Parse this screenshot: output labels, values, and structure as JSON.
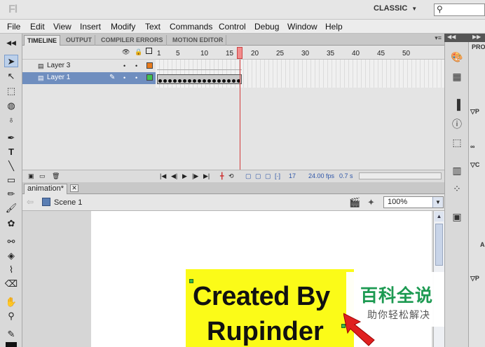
{
  "app": {
    "workspace": "CLASSIC",
    "search_placeholder": ""
  },
  "menu": [
    "File",
    "Edit",
    "View",
    "Insert",
    "Modify",
    "Text",
    "Commands",
    "Control",
    "Debug",
    "Window",
    "Help"
  ],
  "timeline": {
    "tabs": [
      "TIMELINE",
      "OUTPUT",
      "COMPILER ERRORS",
      "MOTION EDITOR"
    ],
    "active_tab": "TIMELINE",
    "layers": [
      {
        "name": "Layer 3",
        "color": "#e87b1c",
        "selected": false
      },
      {
        "name": "Layer 1",
        "color": "#3fc24f",
        "selected": true
      }
    ],
    "ruler": [
      "1",
      "5",
      "10",
      "15",
      "20",
      "25",
      "30",
      "35",
      "40",
      "45",
      "50"
    ],
    "current_frame": "17",
    "fps": "24.00 fps",
    "time": "0.7 s"
  },
  "document": {
    "tab_label": "animation*",
    "scene": "Scene 1",
    "zoom": "100%"
  },
  "stage": {
    "text_line1": "Created By",
    "text_line2": "Rupinder",
    "text_bg": "#fbfb18"
  },
  "watermark": {
    "title": "百科全说",
    "subtitle": "助你轻松解决"
  },
  "right_dock": {
    "labels": [
      "PRO",
      "P",
      "C",
      "A",
      "P"
    ]
  }
}
